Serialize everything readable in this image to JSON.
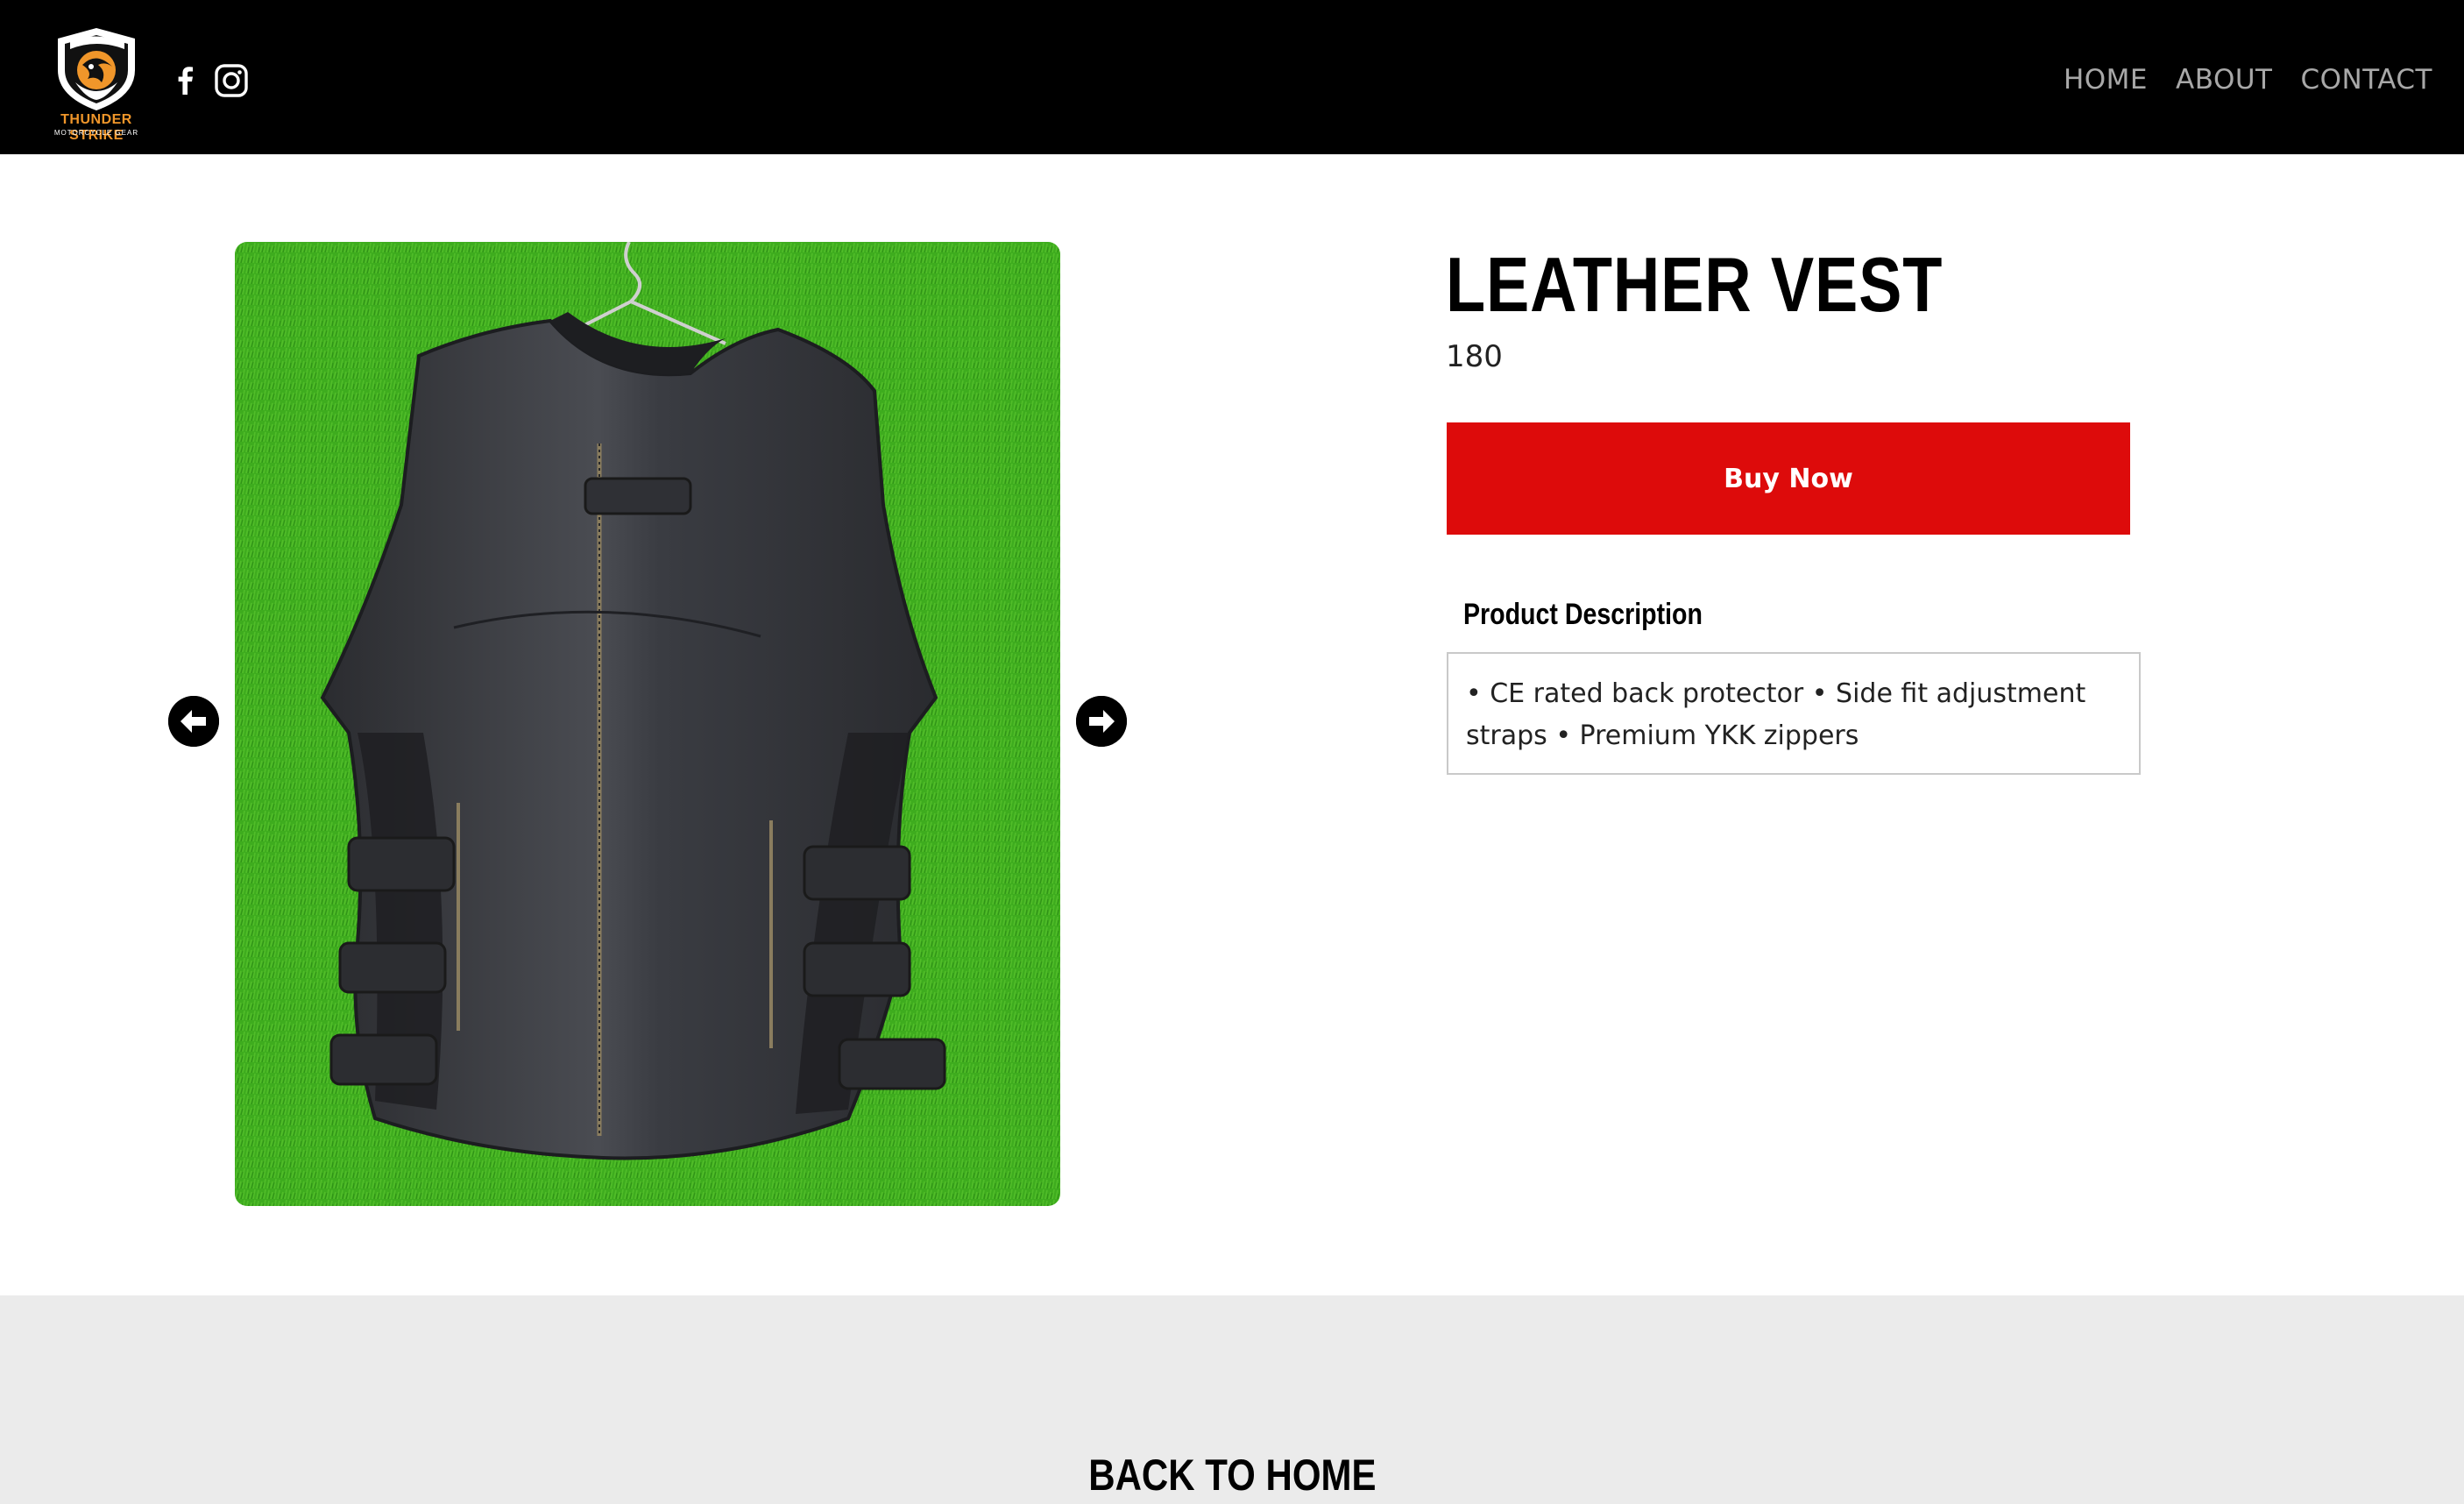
{
  "brand": {
    "name": "THUNDER STRIKE",
    "tagline": "MOTORCYCLE GEAR",
    "accent": "#f0962a"
  },
  "header": {
    "background": "#000000",
    "social": [
      "facebook-icon",
      "instagram-icon"
    ],
    "nav": [
      "HOME",
      "ABOUT",
      "CONTACT"
    ]
  },
  "gallery": {
    "prev_icon": "arrow-left-icon",
    "next_icon": "arrow-right-icon"
  },
  "product": {
    "title": "LEATHER VEST",
    "price": "180",
    "buy_label": "Buy Now",
    "buy_color": "#dd0b0b",
    "description_heading": "Product Description",
    "description": "• CE rated back protector • Side fit adjustment straps • Premium YKK zippers"
  },
  "footer": {
    "back_label": "BACK TO HOME",
    "background": "#ebebeb"
  }
}
